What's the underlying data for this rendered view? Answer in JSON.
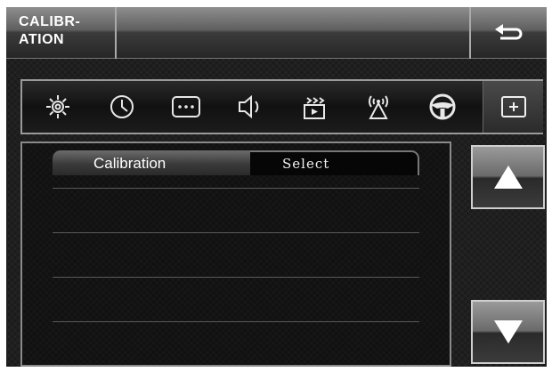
{
  "header": {
    "title_line1": "CALIBR-",
    "title_line2": "ATION",
    "back_icon": "return-arrow-icon"
  },
  "toolbar": {
    "items": [
      {
        "icon": "gear-icon"
      },
      {
        "icon": "clock-icon"
      },
      {
        "icon": "more-dots-icon"
      },
      {
        "icon": "speaker-icon"
      },
      {
        "icon": "video-icon"
      },
      {
        "icon": "antenna-icon"
      },
      {
        "icon": "steering-wheel-icon"
      },
      {
        "icon": "plus-box-icon",
        "active": true
      }
    ]
  },
  "panel": {
    "tab_calibration": "Calibration",
    "tab_select": "Select",
    "row_count": 4
  },
  "scroll": {
    "up_icon": "arrow-up-icon",
    "down_icon": "arrow-down-icon"
  },
  "colors": {
    "background": "#1b1b1b",
    "accent": "#ffffff"
  }
}
